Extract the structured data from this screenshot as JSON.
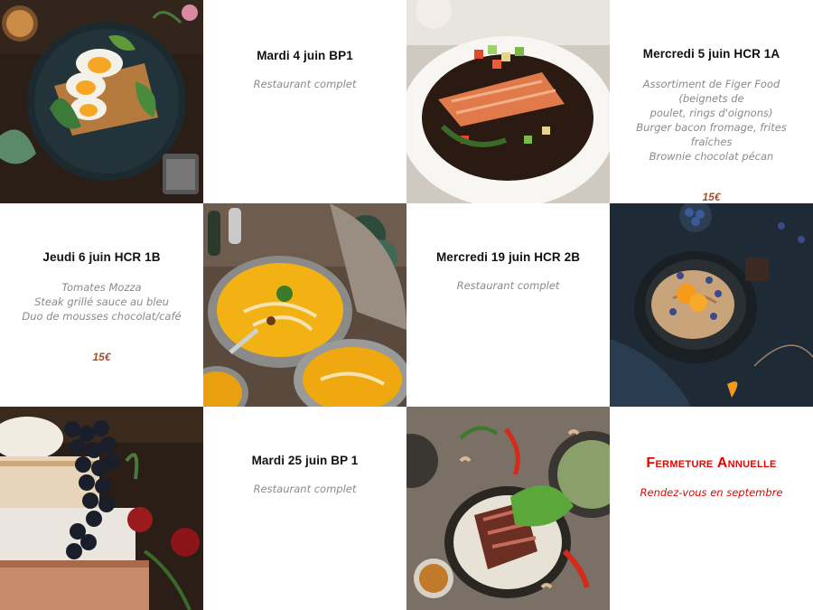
{
  "events": [
    {
      "date": "Mardi 4 juin  BP1",
      "lines": [
        "Restaurant complet"
      ]
    },
    {
      "date": "Mercredi 5 juin  HCR 1A",
      "lines": [
        "Assortiment de Figer Food (beignets de",
        "poulet, rings d'oignons)",
        "Burger bacon fromage, frites fraîches",
        "Brownie chocolat pécan"
      ],
      "price": "15€"
    },
    {
      "date": "Jeudi 6 juin  HCR 1B",
      "lines": [
        "Tomates Mozza",
        "Steak grillé sauce au bleu",
        "Duo de mousses chocolat/café"
      ],
      "price": "15€"
    },
    {
      "date": "Mercredi 19 juin  HCR 2B",
      "lines": [
        "Restaurant complet"
      ]
    },
    {
      "date": "Mardi 25 juin  BP 1",
      "lines": [
        "Restaurant complet"
      ]
    }
  ],
  "closure": {
    "title": "Fermeture Annuelle",
    "subtitle": "Rendez-vous en septembre"
  },
  "colors": {
    "price": "#a0522d",
    "closure": "#e10600",
    "background": "#ffffff"
  },
  "photos": [
    "egg-toast-photo",
    "salmon-plate-photo",
    "soup-bowls-photo",
    "pancake-berries-photo",
    "cheese-grapes-photo",
    "steak-salad-photo"
  ]
}
